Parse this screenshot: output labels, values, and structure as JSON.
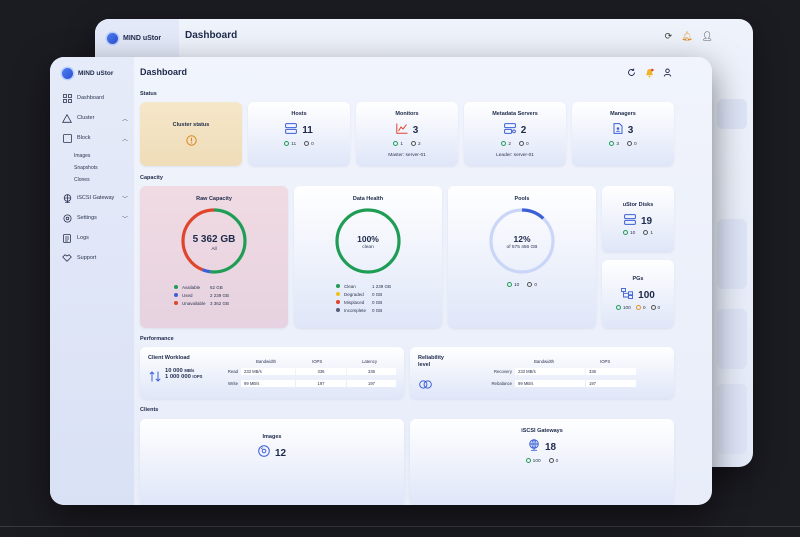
{
  "app": {
    "logo_text": "MIND uStor"
  },
  "header": {
    "title": "Dashboard"
  },
  "back_window": {
    "logo_text": "MIND uStor",
    "title": "Dashboard"
  },
  "sidebar": {
    "items": [
      {
        "label": "Dashboard",
        "icon": "grid-icon"
      },
      {
        "label": "Cluster",
        "icon": "triangle-icon"
      },
      {
        "label": "Block",
        "icon": "block-icon"
      },
      {
        "label": "iSCSI Gateway",
        "icon": "globe-icon"
      },
      {
        "label": "Settings",
        "icon": "gear-icon"
      },
      {
        "label": "Logs",
        "icon": "document-icon"
      },
      {
        "label": "Support",
        "icon": "support-icon"
      }
    ],
    "block_sub": [
      "Images",
      "Snapshots",
      "Clones"
    ]
  },
  "status": {
    "section_title": "Status",
    "cluster": {
      "title": "Cluster status"
    },
    "hosts": {
      "title": "Hosts",
      "value": "11",
      "ok": "11",
      "down": "0"
    },
    "monitors": {
      "title": "Monitors",
      "value": "3",
      "ok": "1",
      "down": "2",
      "note": "Master: server-01"
    },
    "metadata": {
      "title": "Metadata Servers",
      "value": "2",
      "ok": "2",
      "down": "0",
      "note": "Leader: server-01"
    },
    "managers": {
      "title": "Managers",
      "value": "3",
      "ok": "3",
      "down": "0"
    }
  },
  "capacity": {
    "section_title": "Capacity",
    "raw": {
      "title": "Raw Capacity",
      "value": "5 362 GB",
      "sub": "All",
      "legend": [
        {
          "name": "Available",
          "value": "62 GB",
          "color": "#1f9d55"
        },
        {
          "name": "Used",
          "value": "2 239 GB",
          "color": "#3b5fd6"
        },
        {
          "name": "Unavailable",
          "value": "3 362 GB",
          "color": "#e0442b"
        }
      ]
    },
    "health": {
      "title": "Data Health",
      "value": "100%",
      "sub": "clean",
      "legend": [
        {
          "name": "Clean",
          "value": "1 239 GB",
          "color": "#1f9d55"
        },
        {
          "name": "Degraded",
          "value": "0 GB",
          "color": "#f0c020"
        },
        {
          "name": "Misplaced",
          "value": "0 GB",
          "color": "#e0442b"
        },
        {
          "name": "Incomplete",
          "value": "0 GB",
          "color": "#555e7a"
        }
      ]
    },
    "pools": {
      "title": "Pools",
      "value": "12%",
      "sub": "of 575 456 GB",
      "ok": "10",
      "down": "0",
      "fill": 0.12
    },
    "disks": {
      "title": "uStor Disks",
      "value": "19",
      "ok": "10",
      "down": "1"
    },
    "pgs": {
      "title": "PGs",
      "value": "100",
      "ok": "100",
      "warn": "0",
      "down": "0"
    }
  },
  "performance": {
    "section_title": "Performance",
    "client": {
      "title": "Client Workload",
      "bandwidth": "10 000",
      "bandwidth_unit": "MB/s",
      "iops": "1 000 000",
      "iops_unit": "IOPS",
      "headers": [
        "Bandwidth",
        "IOPS",
        "Latency"
      ],
      "rows": [
        {
          "label": "Read",
          "bandwidth": "233 MB/s",
          "iops": "336",
          "latency": "336"
        },
        {
          "label": "Write",
          "bandwidth": "99 MB/s",
          "iops": "197",
          "latency": "197"
        }
      ]
    },
    "reliability": {
      "title_line1": "Reliability",
      "title_line2": "level",
      "headers": [
        "Bandwidth",
        "IOPS"
      ],
      "rows": [
        {
          "label": "Recovery",
          "bandwidth": "233 MB/s",
          "iops": "336"
        },
        {
          "label": "Rebalance",
          "bandwidth": "99 MB/s",
          "iops": "197"
        }
      ]
    }
  },
  "clients": {
    "section_title": "Clients",
    "images": {
      "title": "Images",
      "value": "12"
    },
    "gateways": {
      "title": "iSCSI Gateways",
      "value": "18",
      "ok": "100",
      "down": "0"
    }
  },
  "colors": {
    "accent": "#3b5fd6",
    "ok": "#1f9d55",
    "error": "#e0442b",
    "warning": "#e0922a",
    "cluster_card": "#f3e3c4",
    "raw_card": "#ecd9e2"
  }
}
